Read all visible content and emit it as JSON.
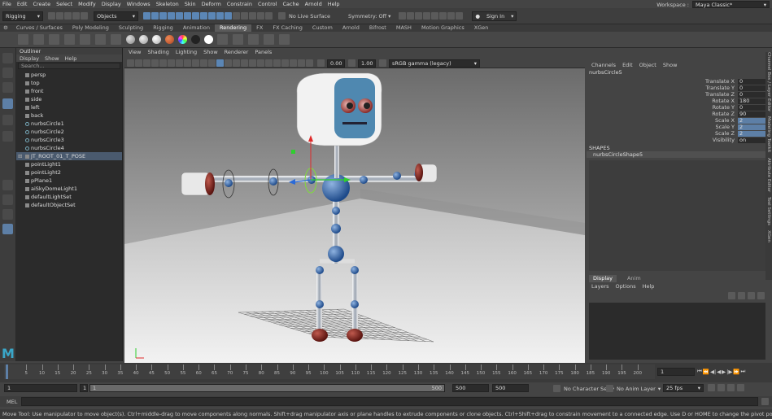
{
  "menubar": {
    "items": [
      "File",
      "Edit",
      "Create",
      "Select",
      "Modify",
      "Display",
      "Windows",
      "Skeleton",
      "Skin",
      "Deform",
      "Constrain",
      "Control",
      "Cache",
      "Arnold",
      "Help"
    ],
    "workspace_label": "Workspace :",
    "workspace_value": "Maya Classic*"
  },
  "statusline": {
    "mode": "Rigging",
    "select_mode": "Objects",
    "live_surface": "No Live Surface",
    "symmetry": "Symmetry: Off",
    "sign_in": "Sign In"
  },
  "shelf_tabs": [
    "Curves / Surfaces",
    "Poly Modeling",
    "Sculpting",
    "Rigging",
    "Animation",
    "Rendering",
    "FX",
    "FX Caching",
    "Custom",
    "Arnold",
    "Bifrost",
    "MASH",
    "Motion Graphics",
    "XGen"
  ],
  "active_shelf": "Rendering",
  "outliner": {
    "title": "Outliner",
    "menus": [
      "Display",
      "Show",
      "Help"
    ],
    "search_placeholder": "Search...",
    "items": [
      {
        "label": "persp",
        "type": "camera"
      },
      {
        "label": "top",
        "type": "camera"
      },
      {
        "label": "front",
        "type": "camera"
      },
      {
        "label": "side",
        "type": "camera"
      },
      {
        "label": "left",
        "type": "camera"
      },
      {
        "label": "back",
        "type": "camera"
      },
      {
        "label": "nurbsCircle1",
        "type": "curve"
      },
      {
        "label": "nurbsCircle2",
        "type": "curve"
      },
      {
        "label": "nurbsCircle3",
        "type": "curve"
      },
      {
        "label": "nurbsCircle4",
        "type": "curve"
      },
      {
        "label": "JT_ROOT_01_T_POSE",
        "type": "joint"
      },
      {
        "label": "pointLight1",
        "type": "light"
      },
      {
        "label": "pointLight2",
        "type": "light"
      },
      {
        "label": "pPlane1",
        "type": "mesh"
      },
      {
        "label": "aiSkyDomeLight1",
        "type": "light"
      },
      {
        "label": "defaultLightSet",
        "type": "set"
      },
      {
        "label": "defaultObjectSet",
        "type": "set"
      }
    ]
  },
  "viewport": {
    "menus": [
      "View",
      "Shading",
      "Lighting",
      "Show",
      "Renderer",
      "Panels"
    ],
    "exposure": "0.00",
    "gamma": "1.00",
    "color_space": "sRGB gamma (legacy)"
  },
  "channel_box": {
    "menus": [
      "Channels",
      "Edit",
      "Object",
      "Show"
    ],
    "object_name": "nurbsCircle5",
    "attributes": [
      {
        "label": "Translate X",
        "value": "0",
        "highlight": false
      },
      {
        "label": "Translate Y",
        "value": "0",
        "highlight": false
      },
      {
        "label": "Translate Z",
        "value": "0",
        "highlight": false
      },
      {
        "label": "Rotate X",
        "value": "180",
        "highlight": false
      },
      {
        "label": "Rotate Y",
        "value": "0",
        "highlight": false
      },
      {
        "label": "Rotate Z",
        "value": "90",
        "highlight": false
      },
      {
        "label": "Scale X",
        "value": "2",
        "highlight": true
      },
      {
        "label": "Scale Y",
        "value": "2",
        "highlight": true
      },
      {
        "label": "Scale Z",
        "value": "2",
        "highlight": true
      },
      {
        "label": "Visibility",
        "value": "on",
        "highlight": false
      }
    ],
    "shapes_label": "SHAPES",
    "shape_name": "nurbsCircleShape5"
  },
  "layer_editor": {
    "tabs": [
      "Display",
      "Anim"
    ],
    "menus": [
      "Layers",
      "Options",
      "Help"
    ]
  },
  "timeslider": {
    "ticks": [
      "5",
      "10",
      "15",
      "20",
      "25",
      "30",
      "35",
      "40",
      "45",
      "50",
      "55",
      "60",
      "65",
      "70",
      "75",
      "80",
      "85",
      "90",
      "95",
      "100",
      "105",
      "110",
      "115",
      "120",
      "125",
      "130",
      "135",
      "140",
      "145",
      "150",
      "155",
      "160",
      "165",
      "170",
      "175",
      "180",
      "185",
      "190",
      "195",
      "200"
    ],
    "current_frame": "1"
  },
  "range": {
    "start": "1",
    "inner_start": "1",
    "slider_label": "1",
    "inner_end": "500",
    "end": "500",
    "end2": "500",
    "character_set": "No Character Set",
    "anim_layer": "No Anim Layer",
    "fps": "25 fps"
  },
  "mel": {
    "label": "MEL"
  },
  "helpline": "Move Tool: Use manipulator to move object(s). Ctrl+middle-drag to move components along normals. Shift+drag manipulator axis or plane handles to extrude components or clone objects. Ctrl+Shift+drag to constrain movement to a connected edge. Use D or HOME to change the pivot position and axis orientation.",
  "side_tabs": [
    "Channel Box / Layer Editor",
    "Modeling Toolkit",
    "Attribute Editor",
    "Tool Settings",
    "XGen"
  ],
  "colors": {
    "accent": "#5d7fa6",
    "selection": "#4a5a6e"
  }
}
